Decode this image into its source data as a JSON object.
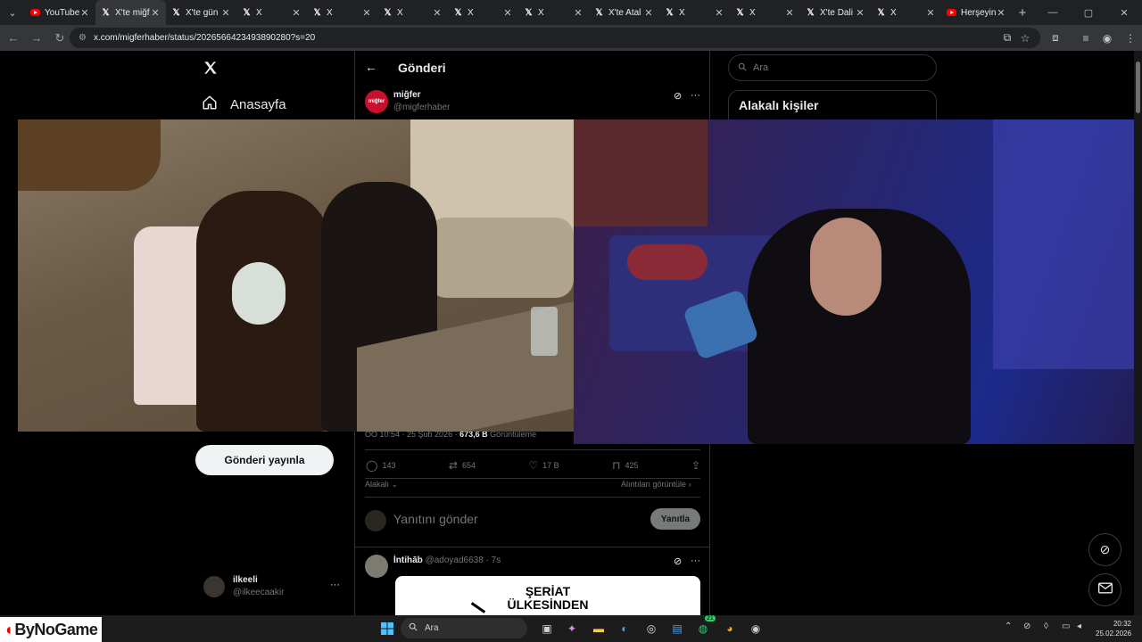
{
  "browser": {
    "tabs": [
      {
        "title": "YouTube",
        "favicon": "youtube-icon",
        "active": false
      },
      {
        "title": "X'te miğf",
        "favicon": "x-icon",
        "active": true
      },
      {
        "title": "X'te gün",
        "favicon": "x-icon",
        "active": false
      },
      {
        "title": "X",
        "favicon": "x-icon",
        "active": false
      },
      {
        "title": "X",
        "favicon": "x-icon",
        "active": false
      },
      {
        "title": "X",
        "favicon": "x-icon",
        "active": false
      },
      {
        "title": "X",
        "favicon": "x-icon",
        "active": false
      },
      {
        "title": "X",
        "favicon": "x-icon",
        "active": false
      },
      {
        "title": "X'te Atal",
        "favicon": "x-icon",
        "active": false
      },
      {
        "title": "X",
        "favicon": "x-icon",
        "active": false
      },
      {
        "title": "X",
        "favicon": "x-icon",
        "active": false
      },
      {
        "title": "X'te Dali",
        "favicon": "x-icon",
        "active": false
      },
      {
        "title": "X",
        "favicon": "x-icon",
        "active": false
      },
      {
        "title": "Herşeyin",
        "favicon": "youtube-icon",
        "active": false
      }
    ],
    "url": "x.com/migferhaber/status/2026566423493890280?s=20"
  },
  "nav": {
    "home_label": "Anasayfa",
    "post_button": "Gönderi yayınla",
    "account_name": "ilkeeli",
    "account_handle": "@ilkeecaakir",
    "more": "···"
  },
  "post": {
    "header_title": "Gönderi",
    "author_name": "miğfer",
    "author_handle": "@migferhaber",
    "avatar_text": "miğfer",
    "more": "···",
    "timestamp": "ÖÖ 10:54 · 25 Şub 2026 · ",
    "views_count": "673,6 B",
    "views_label": " Görüntüleme",
    "replies": "143",
    "reposts": "654",
    "likes": "17 B",
    "bookmarks": "425",
    "relevance_label": "Alakalı",
    "quotes_link": "Alıntıları görüntüle",
    "reply_placeholder": "Yanıtını gönder",
    "reply_button": "Yanıtla"
  },
  "reply": {
    "author_name": "İntihāb",
    "author_handle": "@adoyad6638",
    "age": " · 7s",
    "more": "···",
    "image_line1": "ŞERİAT",
    "image_line2": "ÜLKESİNDEN"
  },
  "sidebar": {
    "search_placeholder": "Ara",
    "related_title": "Alakalı kişiler"
  },
  "taskbar": {
    "search_label": "Ara",
    "whatsapp_badge": "21",
    "time": "20:32",
    "date": "25.02.2026"
  },
  "watermark": {
    "text": "ByNoGame"
  },
  "colors": {
    "background": "#000000",
    "accent_text": "#e7e9ea",
    "muted": "#71767b",
    "border": "#2f3336",
    "youtube_red": "#ff0000"
  }
}
